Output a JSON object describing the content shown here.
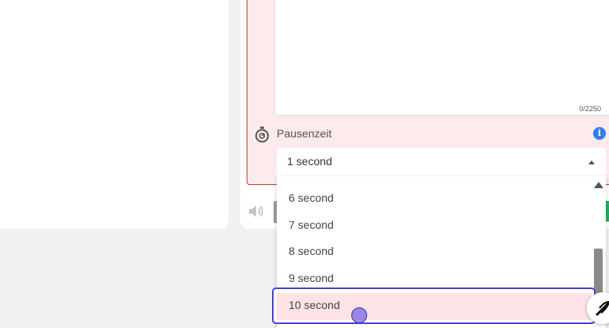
{
  "textarea": {
    "char_count": "0/2250"
  },
  "pause_field": {
    "label": "Pausenzeit",
    "selected_value": "1 second",
    "options": [
      "6 second",
      "7 second",
      "8 second",
      "9 second",
      "10 second"
    ],
    "highlighted_option": "10 second"
  },
  "icons": {
    "stopwatch": "stopwatch-icon",
    "info": "info-icon",
    "speaker": "speaker-icon",
    "scroll_up": "scroll-up-arrow-icon",
    "fab": "quill-icon"
  },
  "colors": {
    "error_border": "#c0392b",
    "error_bg": "#fdeaea",
    "info_blue": "#2f80ed",
    "focus_border": "#4b3fd8",
    "highlight_bg": "#fde3e5",
    "success_green": "#27ae60"
  }
}
